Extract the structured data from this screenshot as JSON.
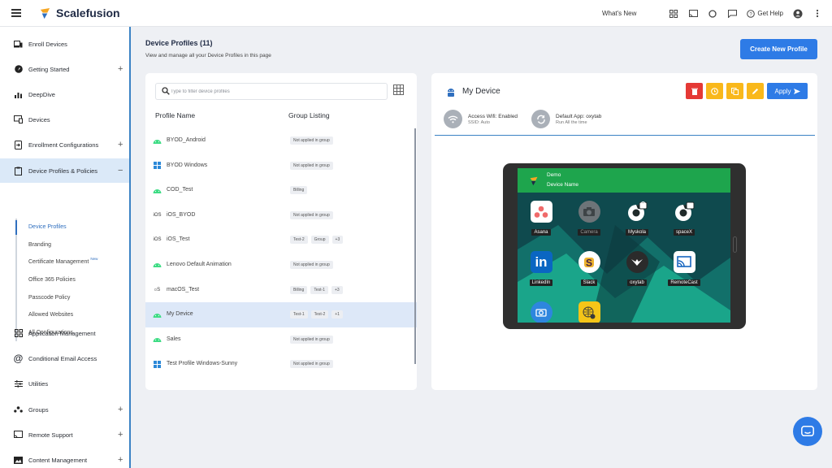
{
  "topbar": {
    "brand": "Scalefusion",
    "whats_new": "What's New",
    "get_help": "Get Help"
  },
  "sidebar": {
    "items": [
      {
        "label": "Enroll Devices",
        "icon": "laptop-phone-icon",
        "expandable": false
      },
      {
        "label": "Getting Started",
        "icon": "rocket-icon",
        "expandable": true
      },
      {
        "label": "DeepDive",
        "icon": "bar-chart-icon",
        "expandable": false
      },
      {
        "label": "Devices",
        "icon": "devices-icon",
        "expandable": false
      },
      {
        "label": "Enrollment Configurations",
        "icon": "enrollment-icon",
        "expandable": true
      },
      {
        "label": "Device Profiles & Policies",
        "icon": "clipboard-icon",
        "expandable": true,
        "active": true
      },
      {
        "label": "Application Management",
        "icon": "apps-grid-icon",
        "expandable": false
      },
      {
        "label": "Conditional Email Access",
        "icon": "at-icon",
        "expandable": false
      },
      {
        "label": "Utilities",
        "icon": "sliders-icon",
        "expandable": false
      },
      {
        "label": "Groups",
        "icon": "groups-icon",
        "expandable": true
      },
      {
        "label": "Remote Support",
        "icon": "cast-icon",
        "expandable": true
      },
      {
        "label": "Content Management",
        "icon": "image-icon",
        "expandable": true
      }
    ],
    "sub_items": [
      {
        "label": "Device Profiles",
        "active": true
      },
      {
        "label": "Branding"
      },
      {
        "label": "Certificate Management",
        "badge": "New"
      },
      {
        "label": "Office 365 Policies"
      },
      {
        "label": "Passcode Policy"
      },
      {
        "label": "Allowed Websites"
      },
      {
        "label": "All Configurations"
      }
    ]
  },
  "page": {
    "title": "Device Profiles (11)",
    "subtitle": "View and manage all your Device Profiles in this page",
    "create_button": "Create New Profile"
  },
  "list": {
    "search_placeholder": "Type to filter device profiles",
    "col_name": "Profile Name",
    "col_group": "Group Listing",
    "rows": [
      {
        "name": "BYOD_Android",
        "os": "android",
        "tags": [
          "Not applied in group"
        ]
      },
      {
        "name": "BYOD Windows",
        "os": "windows",
        "tags": [
          "Not applied in group"
        ]
      },
      {
        "name": "COD_Test",
        "os": "android",
        "tags": [
          "Billing"
        ]
      },
      {
        "name": "iOS_BYOD",
        "os": "ios",
        "tags": [
          "Not applied in group"
        ]
      },
      {
        "name": "iOS_Test",
        "os": "ios",
        "tags": [
          "Test-2",
          "Group",
          "+3"
        ]
      },
      {
        "name": "Lenovo Default Animation",
        "os": "android",
        "tags": [
          "Not applied in group"
        ]
      },
      {
        "name": "macOS_Test",
        "os": "macos",
        "tags": [
          "Billing",
          "Test-1",
          "+3"
        ]
      },
      {
        "name": "My Device",
        "os": "android",
        "tags": [
          "Test-1",
          "Test-2",
          "+1"
        ],
        "selected": true
      },
      {
        "name": "Sales",
        "os": "android",
        "tags": [
          "Not applied in group"
        ]
      },
      {
        "name": "Test Profile Windows-Sunny",
        "os": "windows",
        "tags": [
          "Not applied in group"
        ]
      }
    ],
    "os_labels": {
      "ios": "iOS",
      "macos": "ဝS"
    }
  },
  "detail": {
    "title": "My Device",
    "apply": "Apply",
    "wifi_title": "Access Wifi: Enabled",
    "wifi_sub": "SSID: Auto",
    "app_title": "Default App: oxytab",
    "app_sub": "Run All the time",
    "action_colors": {
      "delete": "#e53935",
      "schedule": "#f9b81b",
      "copy": "#f9b81b",
      "edit": "#f9b81b"
    }
  },
  "device_screen": {
    "header_line1": "Demo",
    "header_line2": "Device Name",
    "apps": [
      {
        "label": "Asana",
        "icon": "asana-icon"
      },
      {
        "label": "Camera",
        "icon": "camera-icon",
        "dim": true
      },
      {
        "label": "Myskola",
        "icon": "chrome-lock-icon"
      },
      {
        "label": "spaceX",
        "icon": "chrome-lock-icon"
      },
      {
        "label": "LinkedIn",
        "icon": "linkedin-icon"
      },
      {
        "label": "Slack",
        "icon": "slack-icon"
      },
      {
        "label": "oxytab",
        "icon": "oxytab-icon"
      },
      {
        "label": "RemoteCast",
        "icon": "remotecast-icon"
      }
    ]
  },
  "colors": {
    "primary": "#2e7be6",
    "android_green": "#3ddc84",
    "windows_blue": "#2b88d8",
    "screen_header_green": "#1ea54d"
  }
}
